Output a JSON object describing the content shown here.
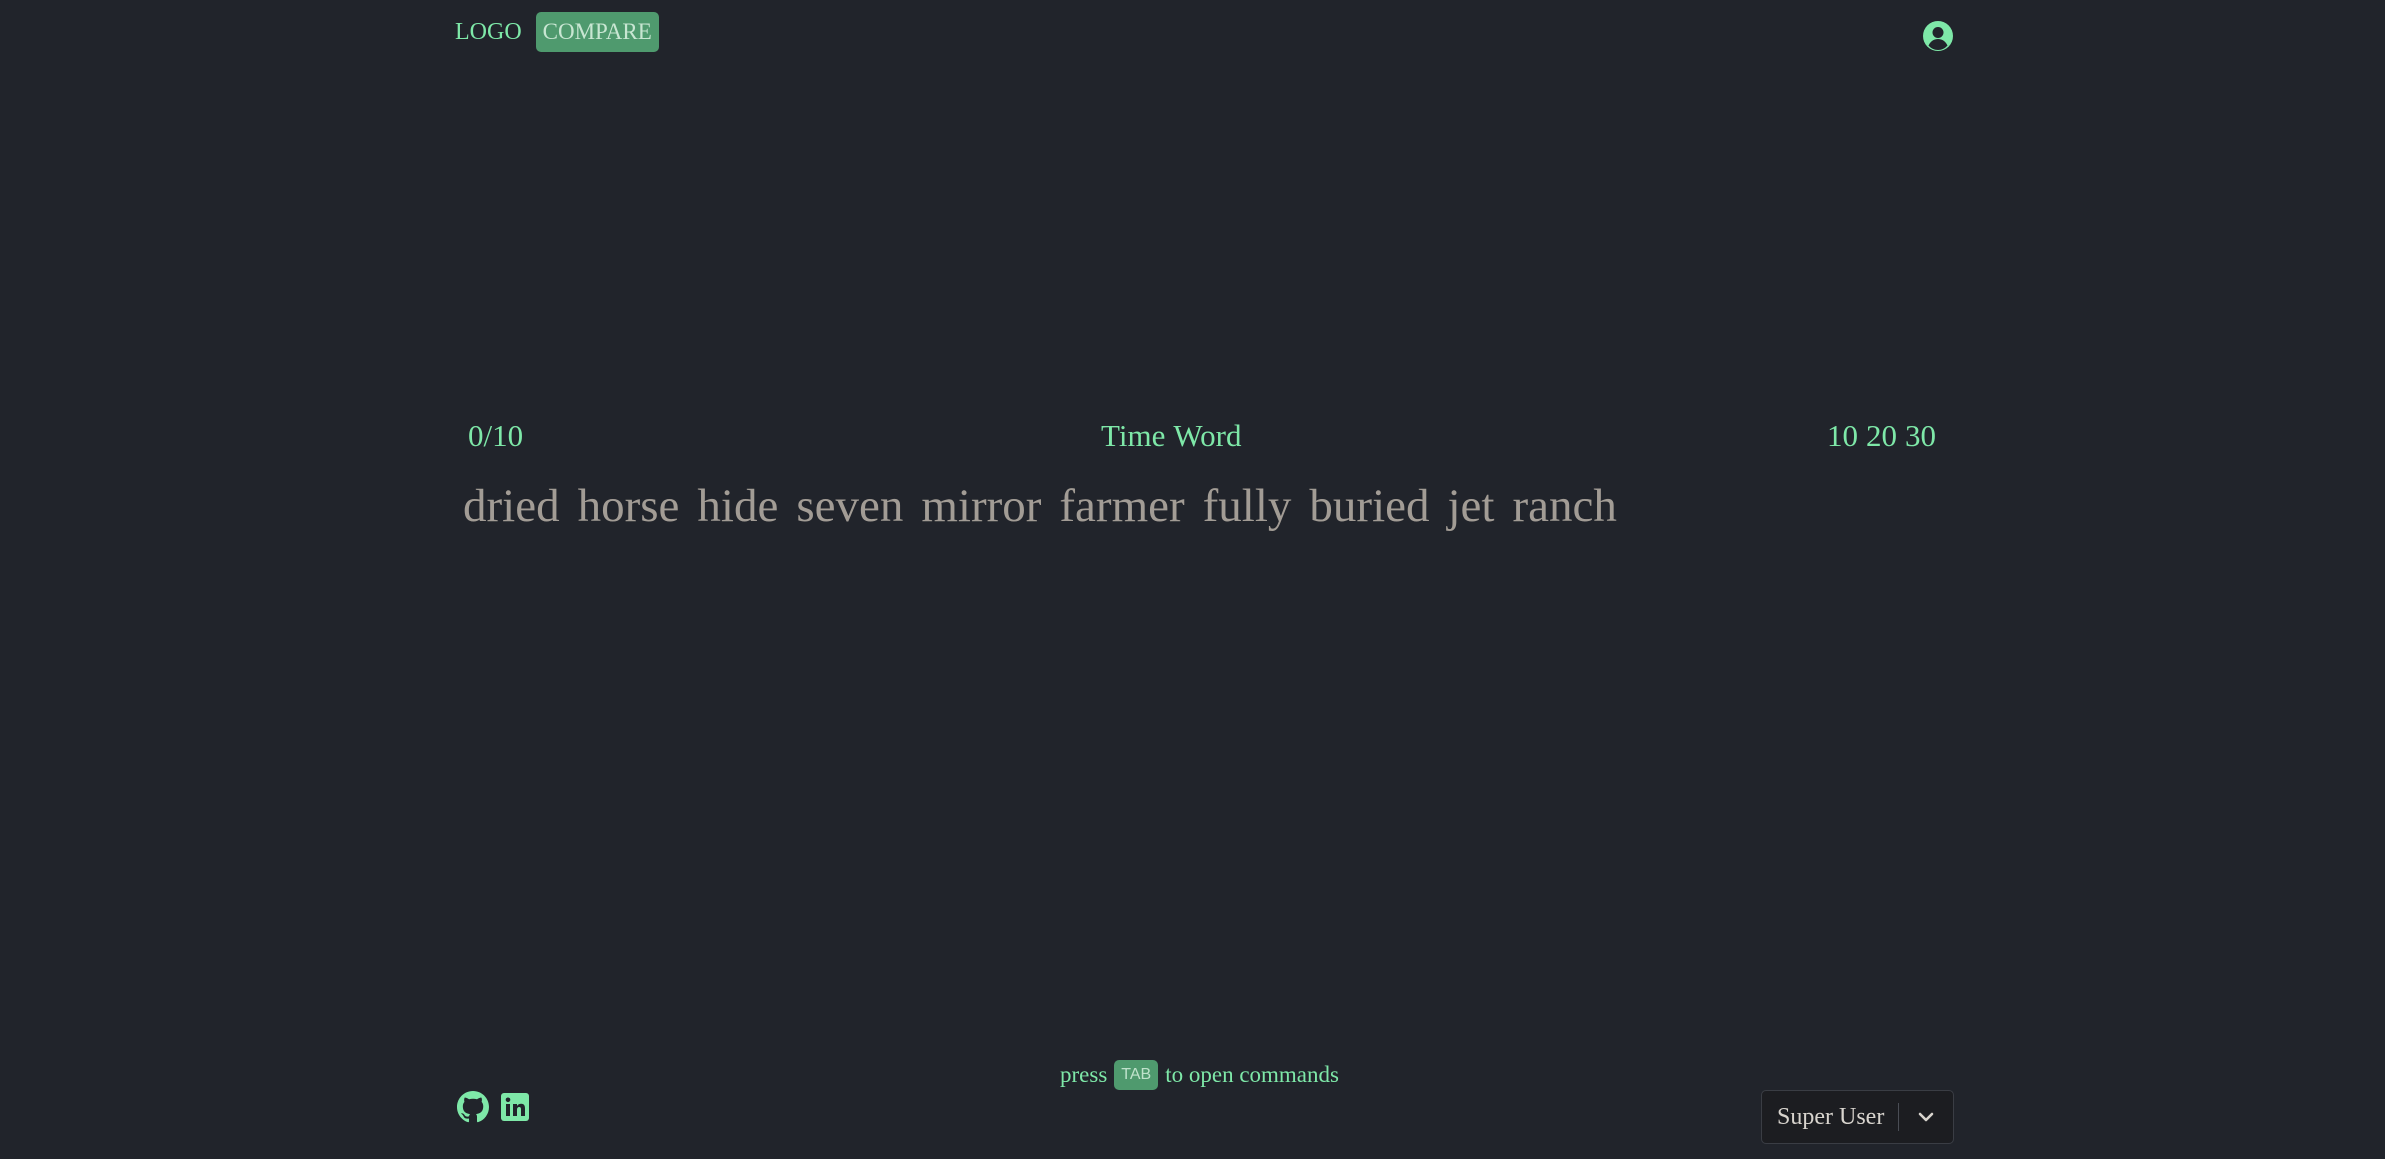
{
  "header": {
    "logo_label": "LOGO",
    "compare_label": "COMPARE",
    "account_icon": "user-circle-icon"
  },
  "test": {
    "progress": "0/10",
    "modes": [
      "Time",
      "Word"
    ],
    "lengths": [
      "10",
      "20",
      "30"
    ],
    "words": [
      "dried",
      "horse",
      "hide",
      "seven",
      "mirror",
      "farmer",
      "fully",
      "buried",
      "jet",
      "ranch"
    ]
  },
  "footer": {
    "hint_prefix": "press",
    "hint_key": "TAB",
    "hint_suffix": "to open commands",
    "social_icons": [
      "github-icon",
      "linkedin-icon"
    ],
    "user_select_value": "Super User"
  },
  "colors": {
    "background": "#21242b",
    "accent": "#7ee8a8",
    "accent_bg": "#4f9a6e",
    "words": "#a29c95"
  }
}
